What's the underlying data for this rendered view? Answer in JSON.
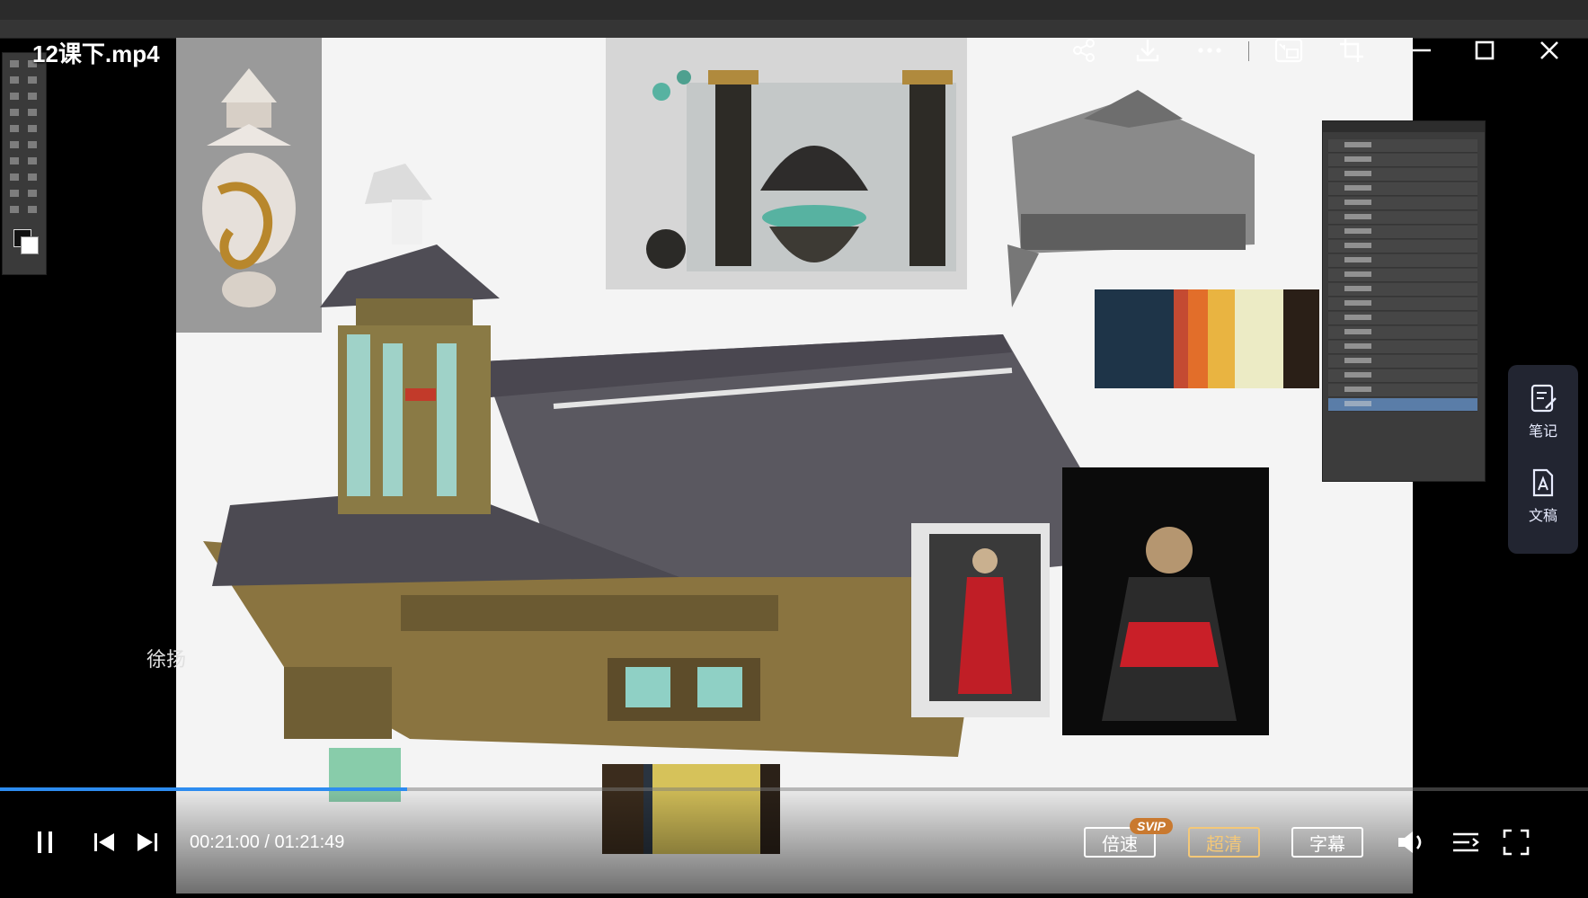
{
  "player": {
    "title": "12课下.mp4",
    "current_time": "00:21:00",
    "duration": "01:21:49",
    "time_display": "00:21:00 / 01:21:49",
    "progress": 0.2566,
    "speed_label": "倍速",
    "svip_badge": "SVIP",
    "quality_label": "超清",
    "subtitle_label": "字幕",
    "subtitle_fragment": "徐扬",
    "accent_color": "#2d8cf0",
    "quality_color": "#f4c878"
  },
  "side_panel": {
    "notes_label": "笔记",
    "transcript_label": "文稿"
  },
  "top_icons": [
    "share-icon",
    "download-icon",
    "more-icon",
    "picture-in-picture-icon",
    "crop-icon",
    "minimize-icon",
    "maximize-icon",
    "close-icon"
  ],
  "palettes": {
    "top": [
      "#1e3448",
      "#c44a32",
      "#e26e2a",
      "#e9b441",
      "#ecebc5",
      "#2a1f17"
    ],
    "bottom": [
      "#3b2c1d",
      "#2a3440",
      "#d6c25a",
      "#e2cc5e",
      "#2b2118"
    ]
  }
}
